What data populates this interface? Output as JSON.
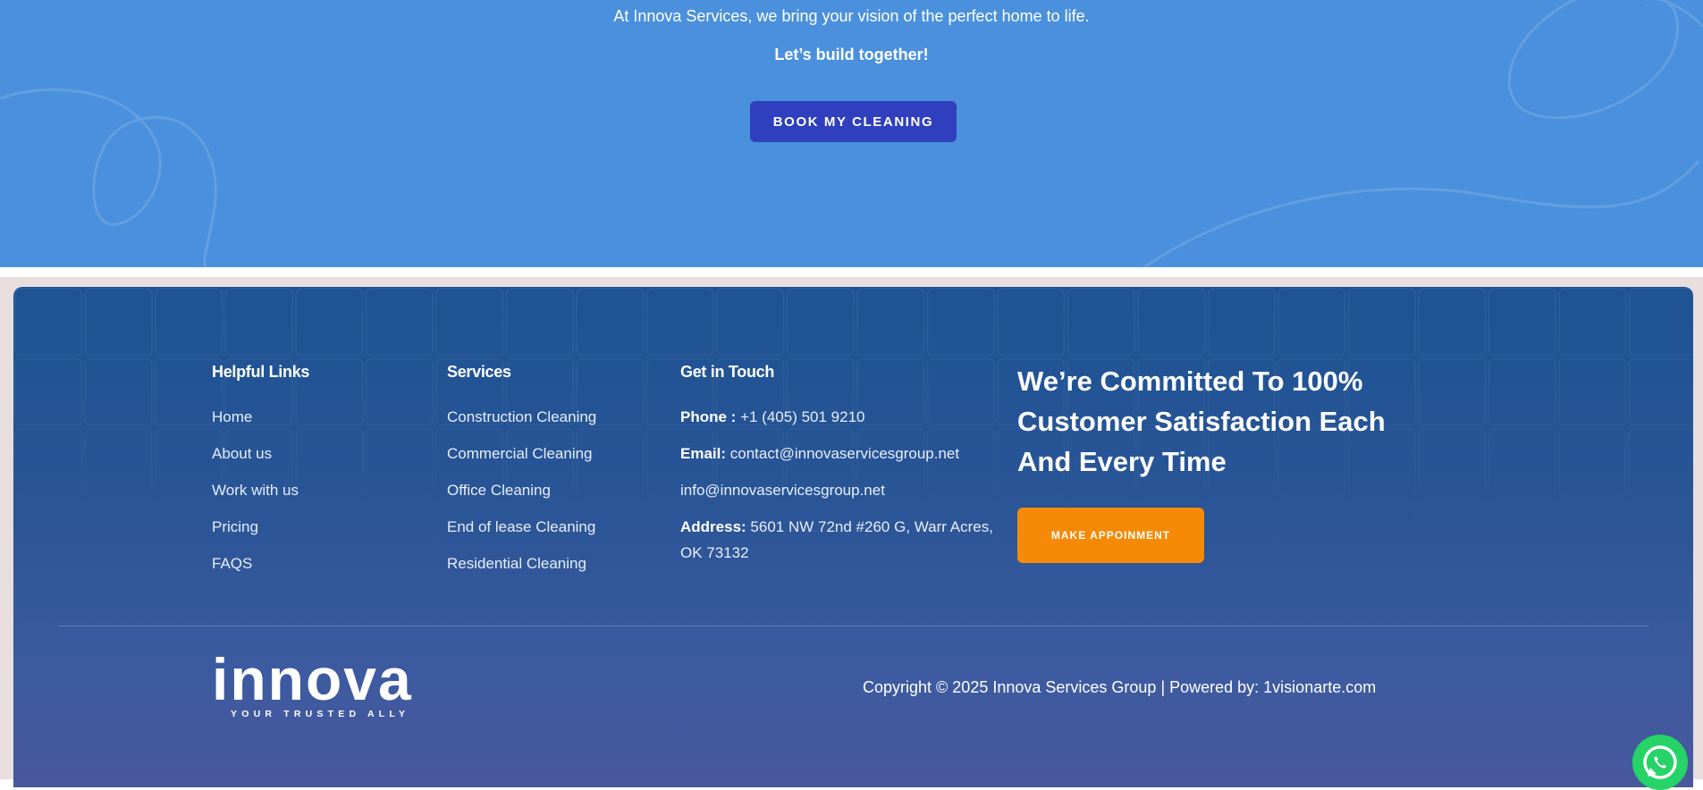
{
  "hero": {
    "subtitle": "At Innova Services, we bring your vision of the perfect home to life.",
    "tagline": "Let’s build together!",
    "cta_label": "BOOK MY CLEANING"
  },
  "footer": {
    "helpful_links": {
      "title": "Helpful Links",
      "items": [
        "Home",
        "About us",
        "Work with us",
        "Pricing",
        "FAQS"
      ]
    },
    "services": {
      "title": "Services",
      "items": [
        "Construction Cleaning",
        "Commercial Cleaning",
        "Office Cleaning",
        "End of lease Cleaning",
        "Residential Cleaning"
      ]
    },
    "contact": {
      "title": "Get in Touch",
      "phone_label": "Phone :",
      "phone": "+1 (405) 501 9210",
      "email_label": "Email:",
      "email": "contact@innovaservicesgroup.net",
      "email2": "info@innovaservicesgroup.net",
      "address_label": "Address:",
      "address_line1": "5601 NW 72nd #260 G, Warr Acres,",
      "address_line2": "OK 73132"
    },
    "headline": "We’re Committed To 100% Customer Satisfaction Each And Every Time",
    "appointment_label": "MAKE APPOINMENT",
    "logo_word": "innova",
    "logo_tagline": "YOUR TRUSTED ALLY",
    "copyright": "Copyright © 2025 Innova Services Group | Powered by: 1visionarte.com"
  },
  "colors": {
    "hero_bg": "#4a90dc",
    "hero_button": "#2f3fbd",
    "footer_top": "#1d5394",
    "footer_bottom": "#48589d",
    "appointment_button": "#f58a07",
    "whatsapp": "#25d366"
  },
  "icons": {
    "whatsapp": "whatsapp-icon"
  }
}
